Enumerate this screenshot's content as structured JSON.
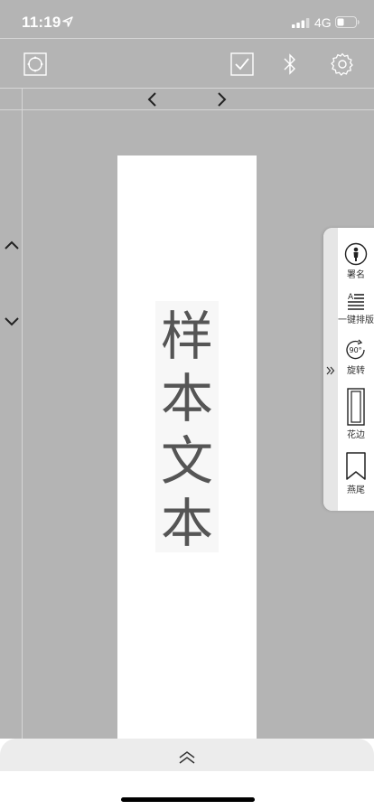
{
  "status_bar": {
    "time": "11:19",
    "network": "4G"
  },
  "toolbar": {
    "icons": [
      "focus-icon",
      "check-icon",
      "bluetooth-icon",
      "settings-icon"
    ]
  },
  "page_nav": {
    "prev": "chevron-left-icon",
    "next": "chevron-right-icon"
  },
  "canvas": {
    "sample_text": [
      "样",
      "本",
      "文",
      "本"
    ]
  },
  "side_panel": {
    "items": [
      {
        "label": "署名",
        "icon": "signature-person-icon"
      },
      {
        "label": "一键排版",
        "icon": "auto-layout-icon"
      },
      {
        "label": "旋转",
        "icon": "rotate-90-icon"
      },
      {
        "label": "花边",
        "icon": "border-frame-icon"
      },
      {
        "label": "燕尾",
        "icon": "swallowtail-icon"
      }
    ]
  },
  "bottom_panel": {
    "icon": "double-chevron-up-icon"
  },
  "colors": {
    "background": "#b4b4b4",
    "paper": "#ffffff",
    "text": "#555555"
  }
}
